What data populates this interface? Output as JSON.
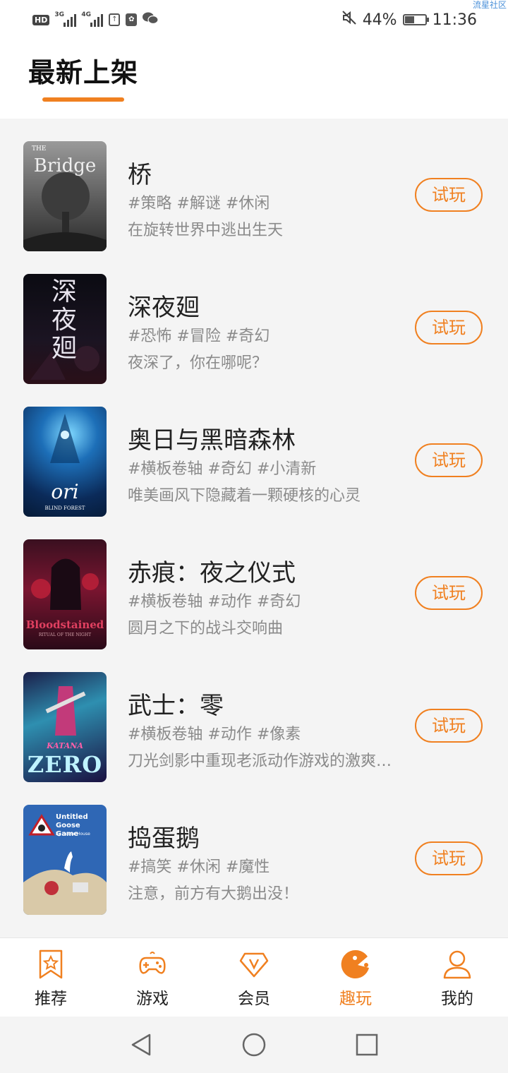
{
  "status_bar": {
    "hd": "HD",
    "net1": "3G",
    "net2": "4G",
    "battery": "44%",
    "time": "11:36",
    "watermark": "流星社区"
  },
  "header": {
    "title": "最新上架"
  },
  "games": [
    {
      "name": "桥",
      "tags": "#策略 #解谜 #休闲",
      "desc": "在旋转世界中逃出生天",
      "button": "试玩",
      "cover_text": "Bridge",
      "cover_small": "THE"
    },
    {
      "name": "深夜廻",
      "tags": "#恐怖 #冒险 #奇幻",
      "desc": "夜深了，你在哪呢？",
      "button": "试玩",
      "cover_text": "深夜廻",
      "cover_small": ""
    },
    {
      "name": "奥日与黑暗森林",
      "tags": "#横板卷轴 #奇幻 #小清新",
      "desc": "唯美画风下隐藏着一颗硬核的心灵",
      "button": "试玩",
      "cover_text": "ori",
      "cover_small": "BLIND FOREST"
    },
    {
      "name": "赤痕：夜之仪式",
      "tags": "#横板卷轴 #动作 #奇幻",
      "desc": "圆月之下的战斗交响曲",
      "button": "试玩",
      "cover_text": "Bloodstained",
      "cover_small": "RITUAL OF THE NIGHT"
    },
    {
      "name": "武士：零",
      "tags": "#横板卷轴 #动作 #像素",
      "desc": "刀光剑影中重现老派动作游戏的激爽…",
      "button": "试玩",
      "cover_text": "ZERO",
      "cover_small": "KATANA"
    },
    {
      "name": "捣蛋鹅",
      "tags": "#搞笑 #休闲 #魔性",
      "desc": "注意，前方有大鹅出没！",
      "button": "试玩",
      "cover_text": "Untitled Goose Game",
      "cover_small": "by House House"
    }
  ],
  "bottom_nav": [
    {
      "label": "推荐",
      "icon": "bookmark-star-icon"
    },
    {
      "label": "游戏",
      "icon": "gamepad-icon"
    },
    {
      "label": "会员",
      "icon": "diamond-v-icon"
    },
    {
      "label": "趣玩",
      "icon": "pacman-icon",
      "active": true
    },
    {
      "label": "我的",
      "icon": "user-icon"
    }
  ],
  "colors": {
    "accent": "#f08020",
    "text": "#222222",
    "muted": "#8a8a8a",
    "background": "#f4f4f4"
  }
}
